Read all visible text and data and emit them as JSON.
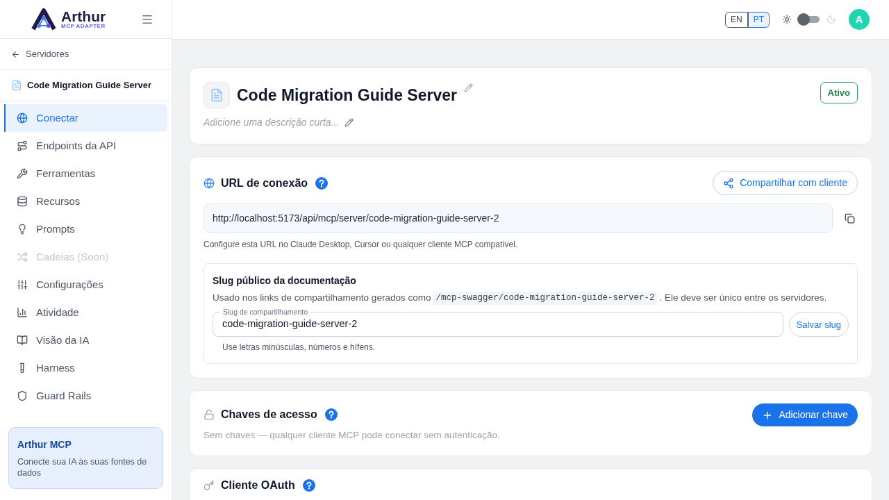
{
  "brand": {
    "name": "Arthur",
    "tagline": "MCP ADAPTER"
  },
  "back_link": "Servidores",
  "server_name": "Code Migration Guide Server",
  "nav": [
    {
      "label": "Conectar",
      "selected": true,
      "disabled": false
    },
    {
      "label": "Endpoints da API",
      "selected": false,
      "disabled": false
    },
    {
      "label": "Ferramentas",
      "selected": false,
      "disabled": false
    },
    {
      "label": "Recursos",
      "selected": false,
      "disabled": false
    },
    {
      "label": "Prompts",
      "selected": false,
      "disabled": false
    },
    {
      "label": "Cadeias (Soon)",
      "selected": false,
      "disabled": true
    },
    {
      "label": "Configurações",
      "selected": false,
      "disabled": false
    },
    {
      "label": "Atividade",
      "selected": false,
      "disabled": false
    },
    {
      "label": "Visão da IA",
      "selected": false,
      "disabled": false
    },
    {
      "label": "Harness",
      "selected": false,
      "disabled": false
    },
    {
      "label": "Guard Rails",
      "selected": false,
      "disabled": false
    }
  ],
  "promo": {
    "title": "Arthur MCP",
    "text": "Conecte sua IA às suas fontes de dados"
  },
  "languages": [
    {
      "label": "EN",
      "selected": false
    },
    {
      "label": "PT",
      "selected": true
    }
  ],
  "dark_mode": {
    "on": false
  },
  "avatar": "A",
  "header_card": {
    "title": "Code Migration Guide Server",
    "description_placeholder": "Adicione uma descrição curta...",
    "status": "Ativo"
  },
  "connection": {
    "title": "URL de conexão",
    "share_button": "Compartilhar com cliente",
    "url": "http://localhost:5173/api/mcp/server/code-migration-guide-server-2",
    "hint": "Configure esta URL no Claude Desktop, Cursor ou qualquer cliente MCP compatível.",
    "slug": {
      "title": "Slug público da documentação",
      "text_before": "Usado nos links de compartilhamento gerados como",
      "code": "/mcp-swagger/code-migration-guide-server-2",
      "text_after": ". Ele deve ser único entre os servidores.",
      "field_label": "Slug de compartilhamento",
      "value": "code-migration-guide-server-2",
      "save_button": "Salvar slug",
      "field_hint": "Use letras minúsculas, números e hífens."
    }
  },
  "access_keys": {
    "title": "Chaves de acesso",
    "add_button": "Adicionar chave",
    "empty_text": "Sem chaves — qualquer cliente MCP pode conectar sem autenticação."
  },
  "oauth": {
    "title": "Cliente OAuth"
  }
}
